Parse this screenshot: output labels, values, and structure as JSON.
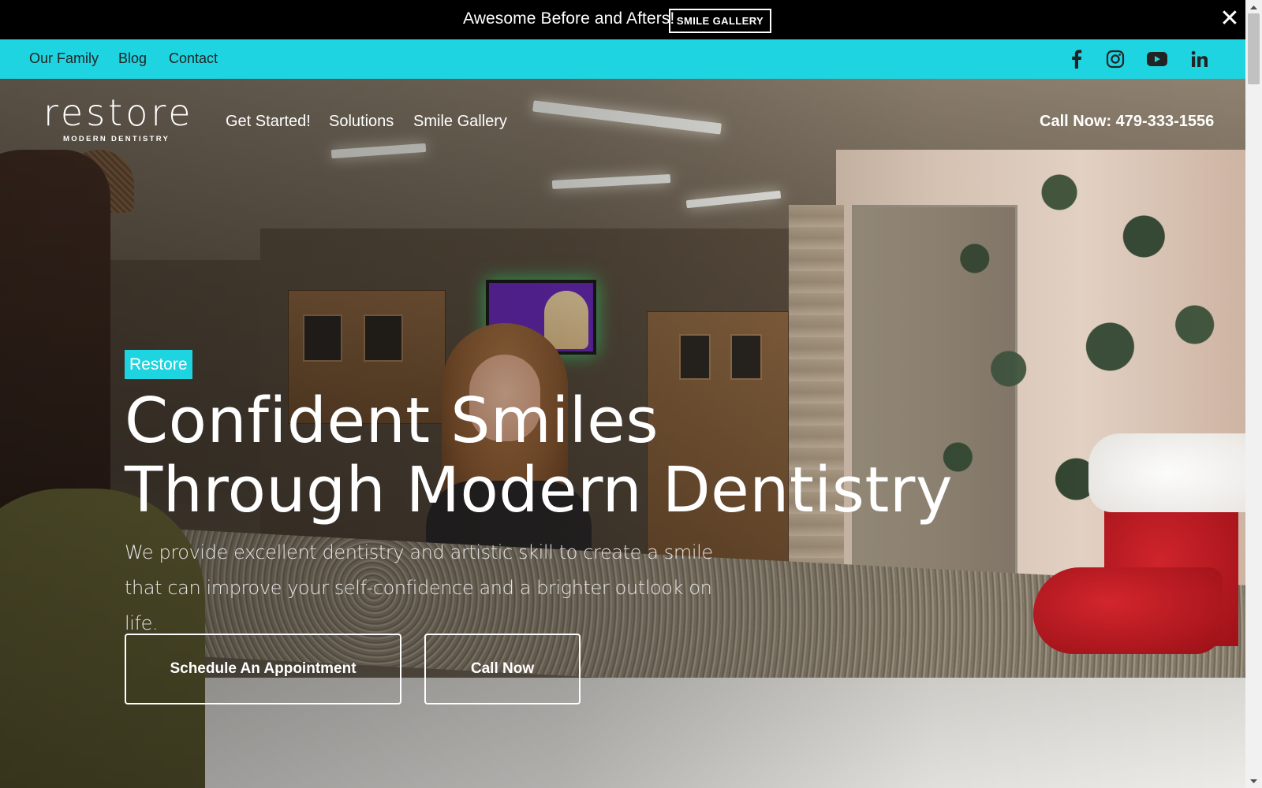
{
  "announcement": {
    "text": "Awesome Before and Afters!",
    "button_label": "SMILE GALLERY",
    "close_icon": "close-icon",
    "close_glyph": "✕"
  },
  "utility_nav": {
    "links": [
      {
        "label": "Our Family"
      },
      {
        "label": "Blog"
      },
      {
        "label": "Contact"
      }
    ],
    "social": [
      {
        "icon": "facebook-icon"
      },
      {
        "icon": "instagram-icon"
      },
      {
        "icon": "youtube-icon"
      },
      {
        "icon": "linkedin-icon"
      }
    ],
    "background_color": "#1fd4e1"
  },
  "header": {
    "logo": {
      "word": "restore",
      "subtitle": "MODERN DENTISTRY"
    },
    "nav": [
      {
        "label": "Get Started!"
      },
      {
        "label": "Solutions"
      },
      {
        "label": "Smile Gallery"
      }
    ],
    "call": "Call Now: 479-333-1556"
  },
  "hero": {
    "tag": "Restore",
    "headline_line1": "Confident Smiles",
    "headline_line2": "Through Modern Dentistry",
    "subtext": "We provide excellent dentistry and artistic skill to create a smile that can improve your self-confidence and a brighter outlook on life.",
    "buttons": [
      {
        "label": "Schedule An Appointment"
      },
      {
        "label": "Call Now"
      }
    ],
    "accent_color": "#1fd4e1"
  }
}
